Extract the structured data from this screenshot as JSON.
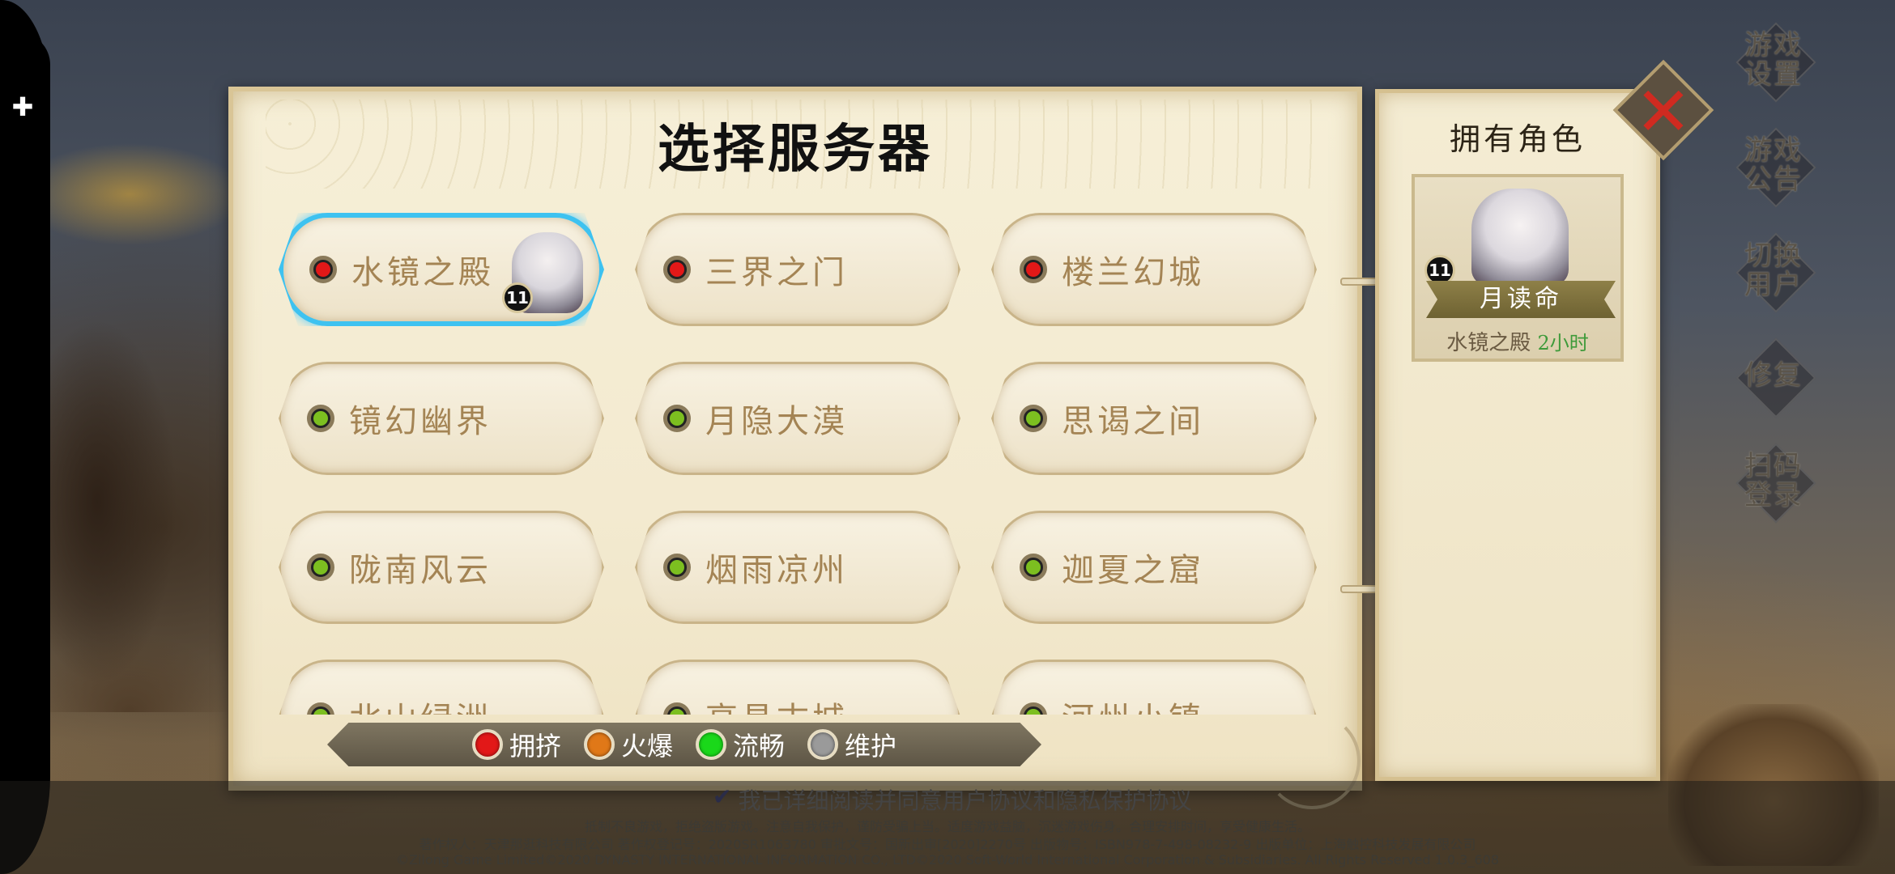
{
  "window": {
    "title": "选择服务器"
  },
  "servers": [
    {
      "name": "水镜之殿",
      "status_color": "#e21818",
      "selected": true,
      "level": "11"
    },
    {
      "name": "三界之门",
      "status_color": "#e21818"
    },
    {
      "name": "楼兰幻城",
      "status_color": "#e21818"
    },
    {
      "name": "镜幻幽界",
      "status_color": "#7cbf20"
    },
    {
      "name": "月隐大漠",
      "status_color": "#7cbf20"
    },
    {
      "name": "思谒之间",
      "status_color": "#7cbf20"
    },
    {
      "name": "陇南风云",
      "status_color": "#7cbf20"
    },
    {
      "name": "烟雨凉州",
      "status_color": "#7cbf20"
    },
    {
      "name": "迦夏之窟",
      "status_color": "#7cbf20"
    },
    {
      "name": "北山绿洲",
      "status_color": "#7cbf20"
    },
    {
      "name": "高昌古城",
      "status_color": "#7cbf20"
    },
    {
      "name": "河州小镇",
      "status_color": "#7cbf20"
    }
  ],
  "legend": [
    {
      "label": "拥挤",
      "color": "#e21818"
    },
    {
      "label": "火爆",
      "color": "#e07818"
    },
    {
      "label": "流畅",
      "color": "#1ad81a"
    },
    {
      "label": "维护",
      "color": "#9a9a9a"
    }
  ],
  "roles": {
    "title": "拥有角色",
    "items": [
      {
        "name": "月读命",
        "level": "11",
        "server": "水镜之殿",
        "time": "2小时"
      }
    ]
  },
  "side_menu": [
    {
      "label": "游戏\n设置"
    },
    {
      "label": "游戏\n公告"
    },
    {
      "label": "切换\n用户"
    },
    {
      "label": "修复"
    },
    {
      "label": "扫码\n登录"
    }
  ],
  "footer": {
    "agreement": "我已详细阅读并同意用户协议和隐私保护协议",
    "line1": "抵制不良游戏，拒绝盗版游戏。注意自我保护，谨防受骗上当。适度游戏益脑，沉迷游戏伤身。合理安排时间，享受健康生活。",
    "line2": "著作权人：天津那逛科技有限公司 著作权登记号：2020SR1063780 审批文号：国新出审[2020]2270号 出版物号：ISBN978-7-498-08232-9 出版单位：上海触控科技发展有限公司",
    "line3": "©Zilong Game Limited©2020 DYNASTY INTERNATIONAL INFORMATION CO., LTD©2020 Soft-World International Corporation & Subsidiaries. All Rights Reserved 1.0.3_608"
  },
  "icons": {
    "puzzle": "puzzle-icon",
    "close": "close-icon",
    "check": "check-icon"
  }
}
